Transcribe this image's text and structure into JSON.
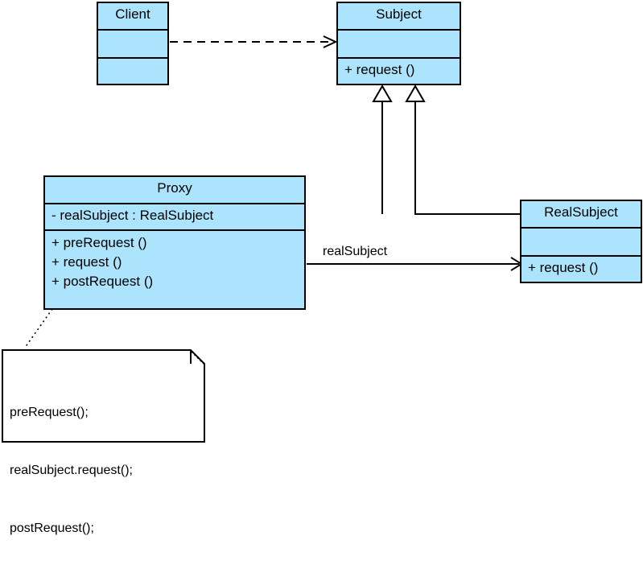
{
  "diagram": {
    "title": "Proxy design pattern UML class diagram",
    "background_color": "#ffffff",
    "class_fill_color": "#ace4fd",
    "line_color": "#000000"
  },
  "classes": {
    "client": {
      "name": "Client",
      "attributes": [],
      "operations": []
    },
    "subject": {
      "name": "Subject",
      "attributes": [],
      "operations": [
        "+  request ()"
      ]
    },
    "proxy": {
      "name": "Proxy",
      "attributes": [
        "-  realSubject  : RealSubject"
      ],
      "operations": [
        "+  preRequest ()",
        "+  request ()",
        "+  postRequest ()"
      ]
    },
    "realsubject": {
      "name": "RealSubject",
      "attributes": [],
      "operations": [
        "+  request ()"
      ]
    }
  },
  "relationships": {
    "client_to_subject": {
      "type": "dependency",
      "style": "dashed",
      "arrow": "open-arrow",
      "from": "Client",
      "to": "Subject",
      "label": ""
    },
    "proxy_to_subject": {
      "type": "generalization",
      "style": "solid",
      "arrow": "hollow-triangle",
      "from": "Proxy",
      "to": "Subject",
      "label": ""
    },
    "realsubject_to_subject": {
      "type": "generalization",
      "style": "solid",
      "arrow": "hollow-triangle",
      "from": "RealSubject",
      "to": "Subject",
      "label": ""
    },
    "proxy_to_realsubject": {
      "type": "association",
      "style": "solid",
      "arrow": "open-arrow",
      "from": "Proxy",
      "to": "RealSubject",
      "label": "realSubject"
    },
    "proxy_to_note": {
      "type": "note-anchor",
      "style": "dotted",
      "arrow": "none",
      "from": "Proxy",
      "to": "note"
    }
  },
  "note": {
    "lines": [
      "preRequest();",
      "realSubject.request();",
      "postRequest();"
    ]
  }
}
